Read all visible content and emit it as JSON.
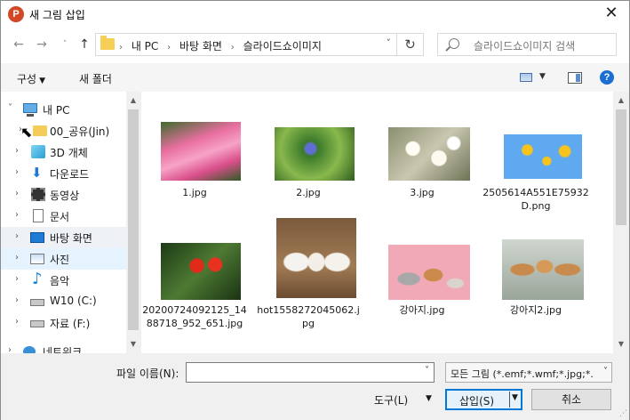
{
  "window": {
    "title": "새 그림 삽입",
    "app_icon": "P"
  },
  "address": {
    "crumbs": [
      "내 PC",
      "바탕 화면",
      "슬라이드쇼이미지"
    ],
    "search_placeholder": "슬라이드쇼이미지 검색"
  },
  "toolbar": {
    "organize": "구성",
    "new_folder": "새 폴더",
    "help": "?"
  },
  "tree": [
    {
      "label": "내 PC",
      "icon": "pc-icon",
      "arrow": "˅"
    },
    {
      "label": "00_공유(Jin)",
      "icon": "folder-icon",
      "arrow": "›"
    },
    {
      "label": "3D 개체",
      "icon": "3d-objects-icon",
      "arrow": "›"
    },
    {
      "label": "다운로드",
      "icon": "download-icon",
      "arrow": "›"
    },
    {
      "label": "동영상",
      "icon": "video-icon",
      "arrow": "›"
    },
    {
      "label": "문서",
      "icon": "document-icon",
      "arrow": "›"
    },
    {
      "label": "바탕 화면",
      "icon": "desktop-icon",
      "arrow": "›"
    },
    {
      "label": "사진",
      "icon": "pictures-icon",
      "arrow": "›"
    },
    {
      "label": "음악",
      "icon": "music-icon",
      "arrow": "›"
    },
    {
      "label": "W10 (C:)",
      "icon": "drive-icon",
      "arrow": "›"
    },
    {
      "label": "자료 (F:)",
      "icon": "drive-icon",
      "arrow": "›"
    },
    {
      "label": "네트워크",
      "icon": "network-icon",
      "arrow": "›"
    }
  ],
  "files": [
    {
      "name": "1.jpg"
    },
    {
      "name": "2.jpg"
    },
    {
      "name": "3.jpg"
    },
    {
      "name": "2505614A551E75932D.png"
    },
    {
      "name": "20200724092125_1488718_952_651.jpg"
    },
    {
      "name": "hot1558272045062.jpg"
    },
    {
      "name": "강아지.jpg"
    },
    {
      "name": "강아지2.jpg"
    }
  ],
  "bottom": {
    "filename_label": "파일 이름(N):",
    "filename_value": "",
    "filter": "모든 그림 (*.emf;*.wmf;*.jpg;*.",
    "tools": "도구(L)",
    "insert": "삽입(S)",
    "cancel": "취소"
  }
}
